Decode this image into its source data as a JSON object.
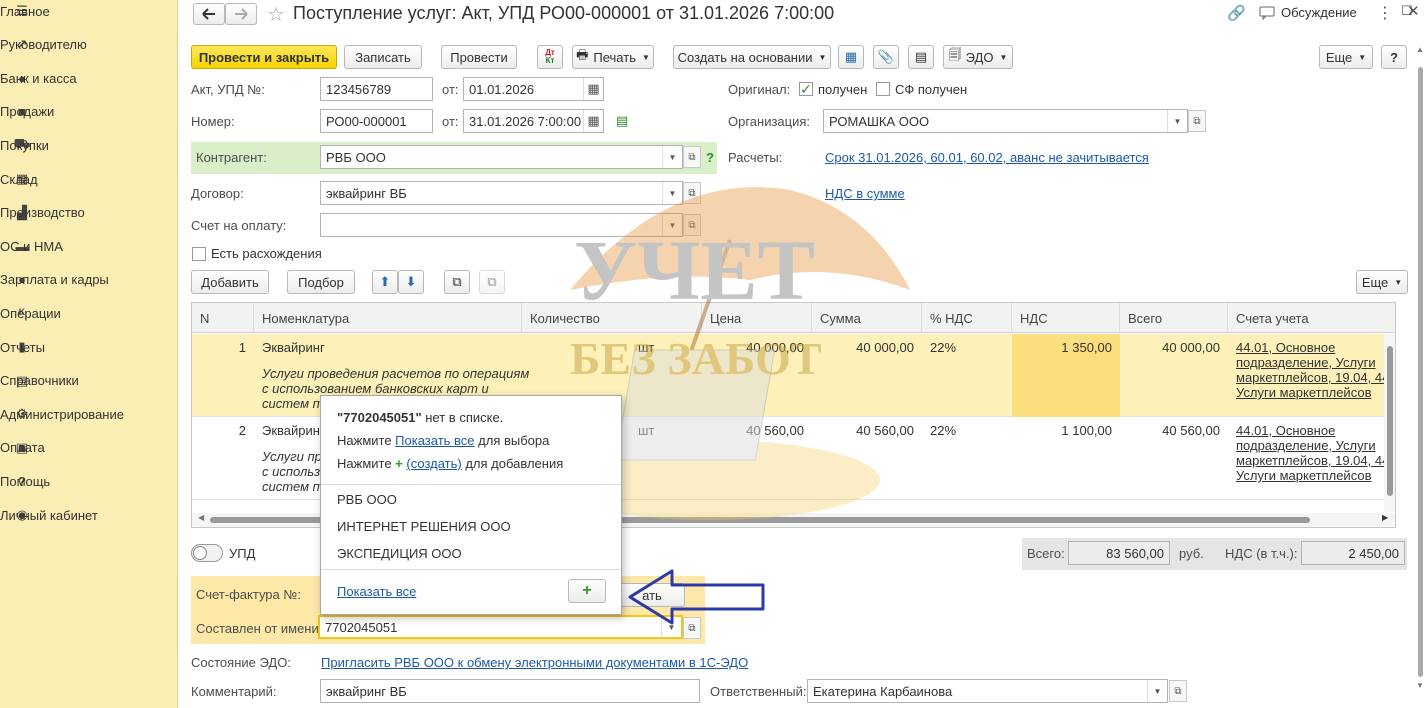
{
  "sidebar": {
    "items": [
      {
        "label": "Главное",
        "icon": "menu-icon"
      },
      {
        "label": "Руководителю",
        "icon": "chart-line-icon"
      },
      {
        "label": "Банк и касса",
        "icon": "coin-icon"
      },
      {
        "label": "Продажи",
        "icon": "bag-icon"
      },
      {
        "label": "Покупки",
        "icon": "cart-icon"
      },
      {
        "label": "Склад",
        "icon": "warehouse-icon"
      },
      {
        "label": "Производство",
        "icon": "factory-icon"
      },
      {
        "label": "ОС и НМА",
        "icon": "truck-icon"
      },
      {
        "label": "Зарплата и кадры",
        "icon": "person-icon"
      },
      {
        "label": "Операции",
        "icon": "dt-kt-icon"
      },
      {
        "label": "Отчеты",
        "icon": "bar-chart-icon"
      },
      {
        "label": "Справочники",
        "icon": "books-icon"
      },
      {
        "label": "Администрирование",
        "icon": "gear-icon"
      },
      {
        "label": "Оплата",
        "icon": "wallet-icon"
      },
      {
        "label": "Помощь",
        "icon": "question-icon"
      },
      {
        "label": "Личный кабинет",
        "icon": "user-circle-icon"
      }
    ]
  },
  "header": {
    "title": "Поступление услуг: Акт, УПД РО00-000001 от 31.01.2026 7:00:00",
    "discussion": "Обсуждение"
  },
  "toolbar": {
    "post_close": "Провести и закрыть",
    "save": "Записать",
    "post": "Провести",
    "dtkt": "Дт Кт",
    "print": "Печать",
    "create_based": "Создать на основании",
    "edo": "ЭДО",
    "more": "Еще",
    "help": "?"
  },
  "form": {
    "act_label": "Акт, УПД №:",
    "act_number": "123456789",
    "from_label": "от:",
    "act_date": "01.01.2026",
    "number_label": "Номер:",
    "number": "РО00-000001",
    "number_date": "31.01.2026  7:00:00",
    "original_label": "Оригинал:",
    "received": "получен",
    "sf_received": "СФ получен",
    "org_label": "Организация:",
    "org": "РОМАШКА ООО",
    "contractor_label": "Контрагент:",
    "contractor": "РВБ ООО",
    "settlements_label": "Расчеты:",
    "settlements_link": "Срок 31.01.2026, 60.01, 60.02, аванс не зачитывается",
    "contract_label": "Договор:",
    "contract": "эквайринг ВБ",
    "vat_link": "НДС в сумме",
    "invoice_label": "Счет на оплату:",
    "invoice": "",
    "discrepancy": "Есть расхождения"
  },
  "table_toolbar": {
    "add": "Добавить",
    "pick": "Подбор",
    "more": "Еще"
  },
  "table": {
    "columns": [
      "N",
      "Номенклатура",
      "Количество",
      "Цена",
      "Сумма",
      "% НДС",
      "НДС",
      "Всего",
      "Счета учета"
    ],
    "rows": [
      {
        "n": "1",
        "name": "Эквайринг",
        "desc1": "Услуги проведения расчетов по операциям",
        "desc2": "с использованием банковских карт и",
        "desc3": "систем п...",
        "unit": "шт",
        "price": "40 000,00",
        "sum": "40 000,00",
        "vat_rate": "22%",
        "vat": "1 350,00",
        "total": "40 000,00",
        "acc1": "44.01, Основное",
        "acc2": "подразделение, Услуги",
        "acc3": "маркетплейсов, 19.04, 44.0",
        "acc4": "Услуги маркетплейсов"
      },
      {
        "n": "2",
        "name": "Эквайринг",
        "desc1": "Услуги пр",
        "desc2": "с использ",
        "desc3": "систем п...",
        "unit": "шт",
        "price": "40 560,00",
        "sum": "40 560,00",
        "vat_rate": "22%",
        "vat": "1 100,00",
        "total": "40 560,00",
        "acc1": "44.01, Основное",
        "acc2": "подразделение, Услуги",
        "acc3": "маркетплейсов, 19.04, 44.0",
        "acc4": "Услуги маркетплейсов"
      }
    ]
  },
  "totals": {
    "upd": "УПД",
    "total_label": "Всего:",
    "total": "83 560,00",
    "currency": "руб.",
    "vat_label": "НДС (в т.ч.):",
    "vat": "2 450,00"
  },
  "bottom": {
    "sf_label": "Счет-фактура №:",
    "sf_button": "ать",
    "composed_label": "Составлен от имени:",
    "composed": "7702045051",
    "edo_label": "Состояние ЭДО:",
    "edo_link": "Пригласить РВБ ООО к обмену электронными документами в 1С-ЭДО",
    "comment_label": "Комментарий:",
    "comment": "эквайринг ВБ",
    "responsible_label": "Ответственный:",
    "responsible": "Екатерина Карбаинова"
  },
  "popup": {
    "msg_value": "\"7702045051\"",
    "msg_rest": " нет в списке.",
    "press": "Нажмите ",
    "show_all_inline": "Показать все",
    "for_select": " для выбора",
    "press2": "Нажмите ",
    "create": "(создать)",
    "for_add": " для добавления",
    "options": [
      "РВБ ООО",
      "ИНТЕРНЕТ РЕШЕНИЯ ООО",
      "ЭКСПЕДИЦИЯ ООО"
    ],
    "show_all": "Показать все"
  },
  "watermark": {
    "line1": "УЧЕТ",
    "line2": "БЕЗ ЗАБОТ"
  },
  "colors": {
    "sidebar_bg": "#fbeeb4",
    "primary_button": "#f6d400",
    "link": "#1c5aa8",
    "highlight": "#fdf0b8",
    "contractor_bg": "#d9efc9",
    "arrow": "#2b3aa8"
  }
}
